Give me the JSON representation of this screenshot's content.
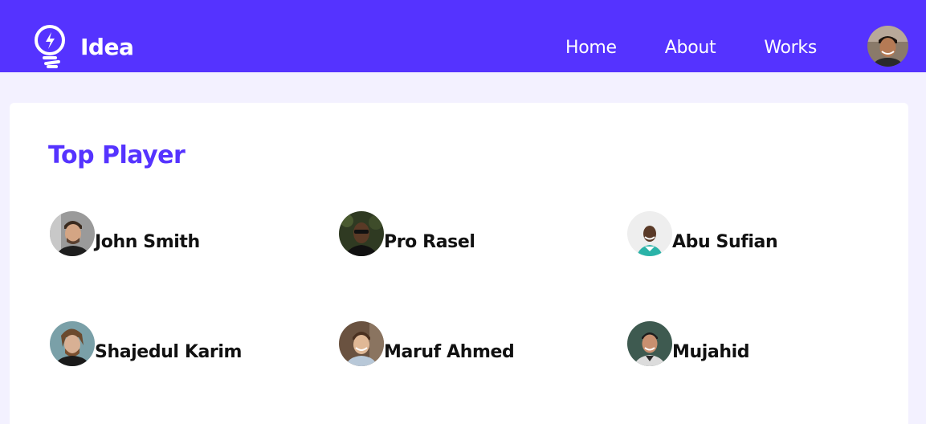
{
  "header": {
    "brand_name": "Idea",
    "brand_icon": "lightbulb-icon",
    "nav": [
      {
        "label": "Home"
      },
      {
        "label": "About"
      },
      {
        "label": "Works"
      }
    ],
    "user_avatar": "user-avatar"
  },
  "main": {
    "section_title": "Top Player",
    "players": [
      {
        "name": "John Smith"
      },
      {
        "name": "Pro Rasel"
      },
      {
        "name": "Abu Sufian"
      },
      {
        "name": "Shajedul Karim"
      },
      {
        "name": "Maruf Ahmed"
      },
      {
        "name": "Mujahid"
      }
    ]
  },
  "colors": {
    "primary": "#5533ff",
    "page_background": "#f3f1ff",
    "card_background": "#ffffff",
    "text": "#111111"
  }
}
